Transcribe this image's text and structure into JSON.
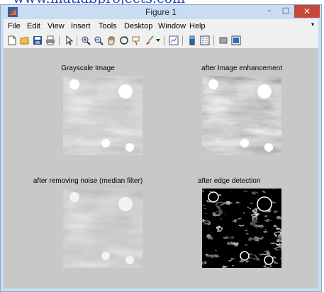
{
  "window": {
    "title": "Figure 1",
    "close_glyph": "✕",
    "minimize_glyph": "–",
    "maximize_glyph": "□"
  },
  "menu": {
    "items": [
      "File",
      "Edit",
      "View",
      "Insert",
      "Tools",
      "Desktop",
      "Window",
      "Help"
    ],
    "overflow_glyph": "▾"
  },
  "toolbar": {
    "icons": [
      "new-figure-icon",
      "open-file-icon",
      "save-icon",
      "print-icon",
      "select-arrow-icon",
      "zoom-in-icon",
      "zoom-out-icon",
      "pan-icon",
      "rotate-3d-icon",
      "data-cursor-icon",
      "brush-icon",
      "link-plot-icon",
      "insert-colorbar-icon",
      "insert-legend-icon",
      "hide-plot-tools-icon",
      "show-plot-tools-icon"
    ]
  },
  "axes": [
    {
      "title": "Grayscale Image",
      "style": "grayscale"
    },
    {
      "title": "after Image enhancement",
      "style": "enhanced"
    },
    {
      "title": "after removing noise (median filter)",
      "style": "median"
    },
    {
      "title": "after edge detection",
      "style": "edges"
    }
  ],
  "colors": {
    "title_bar": "#c9dcf2",
    "close_button": "#c7473a",
    "figure_background": "#c8c8c8",
    "menu_background": "#f0f0f0"
  }
}
